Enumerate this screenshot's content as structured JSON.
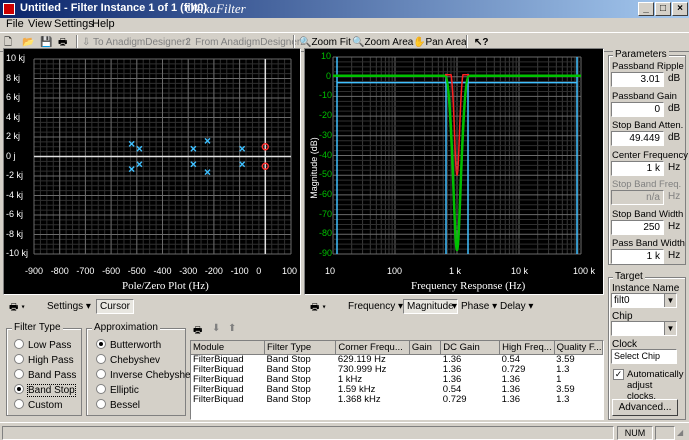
{
  "window": {
    "title": "Untitled - Filter Instance 1 of 1 (filt0)",
    "brand": "OkikaFilter"
  },
  "menu": [
    "File",
    "View",
    "Settings",
    "Help"
  ],
  "toolbar": {
    "to_anadigm": "To AnadigmDesigner2",
    "from_anadigm": "From AnadigmDesigner2",
    "zoom_fit": "Zoom Fit",
    "zoom_area": "Zoom Area",
    "pan_area": "Pan Area"
  },
  "polezero": {
    "title": "Pole/Zero Plot (Hz)",
    "y_ticks": [
      "10 kj",
      "8 kj",
      "6 kj",
      "4 kj",
      "2 kj",
      "0 j",
      "-2 kj",
      "-4 kj",
      "-6 kj",
      "-8 kj",
      "-10 kj"
    ],
    "x_ticks": [
      "-900",
      "-800",
      "-700",
      "-600",
      "-500",
      "-400",
      "-300",
      "-200",
      "-100",
      "0",
      "100"
    ],
    "poles": [
      [
        -520,
        1.3
      ],
      [
        -520,
        -1.3
      ],
      [
        -490,
        0.8
      ],
      [
        -490,
        -0.8
      ],
      [
        -280,
        0.8
      ],
      [
        -280,
        -0.8
      ],
      [
        -225,
        1.6
      ],
      [
        -225,
        -1.6
      ],
      [
        -90,
        0.8
      ],
      [
        -90,
        -0.8
      ]
    ],
    "zeros": [
      [
        0,
        1.0
      ],
      [
        0,
        -1.0
      ]
    ],
    "xlim": [
      -900,
      100
    ],
    "ylim": [
      -10,
      10
    ]
  },
  "freqresp": {
    "title": "Frequency Response (Hz)",
    "ylabel": "Magnitude (dB)",
    "y_ticks": [
      "10",
      "0",
      "-10",
      "-20",
      "-30",
      "-40",
      "-50",
      "-60",
      "-70",
      "-80",
      "-90"
    ],
    "x_ticks": [
      "10",
      "100",
      "1 k",
      "10 k",
      "100 k"
    ],
    "xlim": [
      10,
      100000
    ],
    "ylim": [
      -90,
      10
    ]
  },
  "pz_toolbar": {
    "settings": "Settings",
    "cursor": "Cursor"
  },
  "fr_toolbar": {
    "frequency": "Frequency",
    "magnitude": "Magnitude",
    "phase": "Phase",
    "delay": "Delay"
  },
  "filter_type": {
    "title": "Filter Type",
    "options": [
      "Low Pass",
      "High Pass",
      "Band Pass",
      "Band Stop",
      "Custom"
    ],
    "selected": "Band Stop"
  },
  "approximation": {
    "title": "Approximation",
    "options": [
      "Butterworth",
      "Chebyshev",
      "Inverse Chebyshev",
      "Elliptic",
      "Bessel"
    ],
    "selected": "Butterworth"
  },
  "table": {
    "headers": [
      "Module",
      "Filter Type",
      "Corner Frequ...",
      "Gain",
      "DC Gain",
      "High Freq...",
      "Quality F..."
    ],
    "rows": [
      [
        "FilterBiquad",
        "Band Stop",
        "629.119 Hz",
        "",
        "1.36",
        "0.54",
        "3.59"
      ],
      [
        "FilterBiquad",
        "Band Stop",
        "730.999 Hz",
        "",
        "1.36",
        "0.729",
        "1.3"
      ],
      [
        "FilterBiquad",
        "Band Stop",
        "1 kHz",
        "",
        "1.36",
        "1.36",
        "1"
      ],
      [
        "FilterBiquad",
        "Band Stop",
        "1.59 kHz",
        "",
        "0.54",
        "1.36",
        "3.59"
      ],
      [
        "FilterBiquad",
        "Band Stop",
        "1.368 kHz",
        "",
        "0.729",
        "1.36",
        "1.3"
      ]
    ]
  },
  "parameters": {
    "title": "Parameters",
    "items": [
      {
        "label": "Passband Ripple",
        "value": "3.01",
        "unit": "dB",
        "disabled": false
      },
      {
        "label": "Passband Gain",
        "value": "0",
        "unit": "dB",
        "disabled": false
      },
      {
        "label": "Stop Band Atten.",
        "value": "49.449",
        "unit": "dB",
        "disabled": false
      },
      {
        "label": "Center Frequency",
        "value": "1 k",
        "unit": "Hz",
        "disabled": false
      },
      {
        "label": "Stop Band Freq.",
        "value": "n/a",
        "unit": "Hz",
        "disabled": true
      },
      {
        "label": "Stop Band Width",
        "value": "250",
        "unit": "Hz",
        "disabled": false
      },
      {
        "label": "Pass Band Width",
        "value": "1 k",
        "unit": "Hz",
        "disabled": false
      }
    ]
  },
  "target": {
    "title": "Target",
    "instance_label": "Instance Name",
    "instance_value": "filt0",
    "chip_label": "Chip",
    "chip_value": "",
    "clock_label": "Clock",
    "clock_value": "Select Chip Fir",
    "auto_adjust": "Automatically adjust clocks.",
    "advanced": "Advanced..."
  },
  "status": {
    "num": "NUM"
  }
}
